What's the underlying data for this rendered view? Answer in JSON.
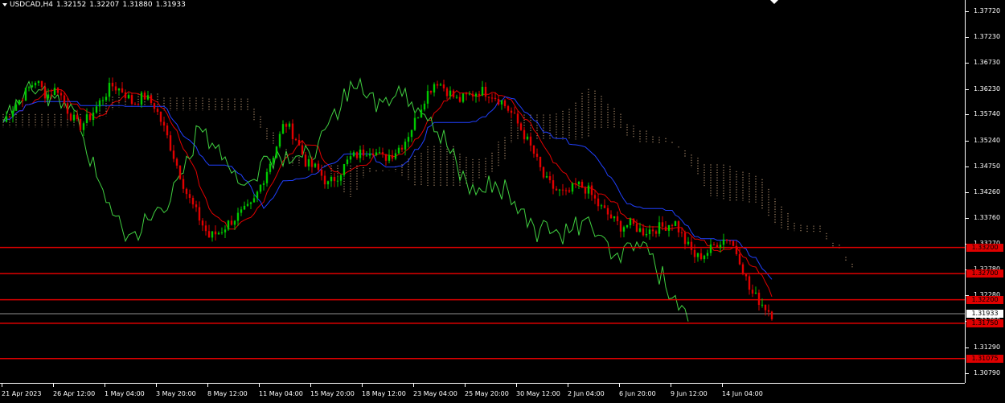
{
  "header": {
    "symbol_timeframe": "USDCAD,H4",
    "open": "1.32152",
    "high": "1.32207",
    "low": "1.31880",
    "close": "1.31933"
  },
  "price_axis": {
    "labels": [
      "1.37720",
      "1.37230",
      "1.36730",
      "1.36230",
      "1.35740",
      "1.35240",
      "1.34750",
      "1.34260",
      "1.33760",
      "1.33270",
      "1.32780",
      "1.32280",
      "1.31790",
      "1.31290",
      "1.30790"
    ],
    "levels": [
      {
        "value": 1.332,
        "label": "1.33200",
        "color": "#e00000"
      },
      {
        "value": 1.327,
        "label": "1.32700",
        "color": "#e00000"
      },
      {
        "value": 1.322,
        "label": "1.32200",
        "color": "#e00000"
      },
      {
        "value": 1.3175,
        "label": "1.31750",
        "color": "#e00000"
      },
      {
        "value": 1.31075,
        "label": "1.31075",
        "color": "#e00000"
      }
    ],
    "current_price": {
      "value": 1.31933,
      "label": "1.31933"
    }
  },
  "time_axis": {
    "labels": [
      "21 Apr 2023",
      "26 Apr 12:00",
      "1 May 04:00",
      "3 May 20:00",
      "8 May 12:00",
      "11 May 04:00",
      "15 May 20:00",
      "18 May 12:00",
      "23 May 04:00",
      "25 May 20:00",
      "30 May 12:00",
      "2 Jun 04:00",
      "6 Jun 20:00",
      "9 Jun 12:00",
      "14 Jun 04:00"
    ]
  },
  "chart_data": {
    "type": "candlestick",
    "title": "USDCAD,H4",
    "ylim": [
      1.3061,
      1.3793
    ],
    "close_path": [
      1.356,
      1.359,
      1.3615,
      1.364,
      1.361,
      1.3625,
      1.358,
      1.355,
      1.357,
      1.36,
      1.363,
      1.362,
      1.3595,
      1.361,
      1.359,
      1.354,
      1.348,
      1.342,
      1.338,
      1.334,
      1.335,
      1.337,
      1.3385,
      1.34,
      1.345,
      1.35,
      1.356,
      1.353,
      1.348,
      1.347,
      1.344,
      1.346,
      1.349,
      1.35,
      1.351,
      1.349,
      1.35,
      1.352,
      1.356,
      1.361,
      1.364,
      1.362,
      1.36,
      1.361,
      1.362,
      1.3615,
      1.36,
      1.3575,
      1.354,
      1.35,
      1.345,
      1.343,
      1.342,
      1.344,
      1.343,
      1.34,
      1.338,
      1.336,
      1.3365,
      1.335,
      1.3355,
      1.336,
      1.337,
      1.333,
      1.33,
      1.331,
      1.333,
      1.334,
      1.33,
      1.3235,
      1.3215,
      1.3193
    ],
    "colors": {
      "bull": "#00c800",
      "bear": "#e00000",
      "tenkan": "#e00000",
      "kijun": "#2040ff",
      "chikou": "#40d040",
      "cloud": "#ffd0a0",
      "level": "#e00000"
    }
  }
}
